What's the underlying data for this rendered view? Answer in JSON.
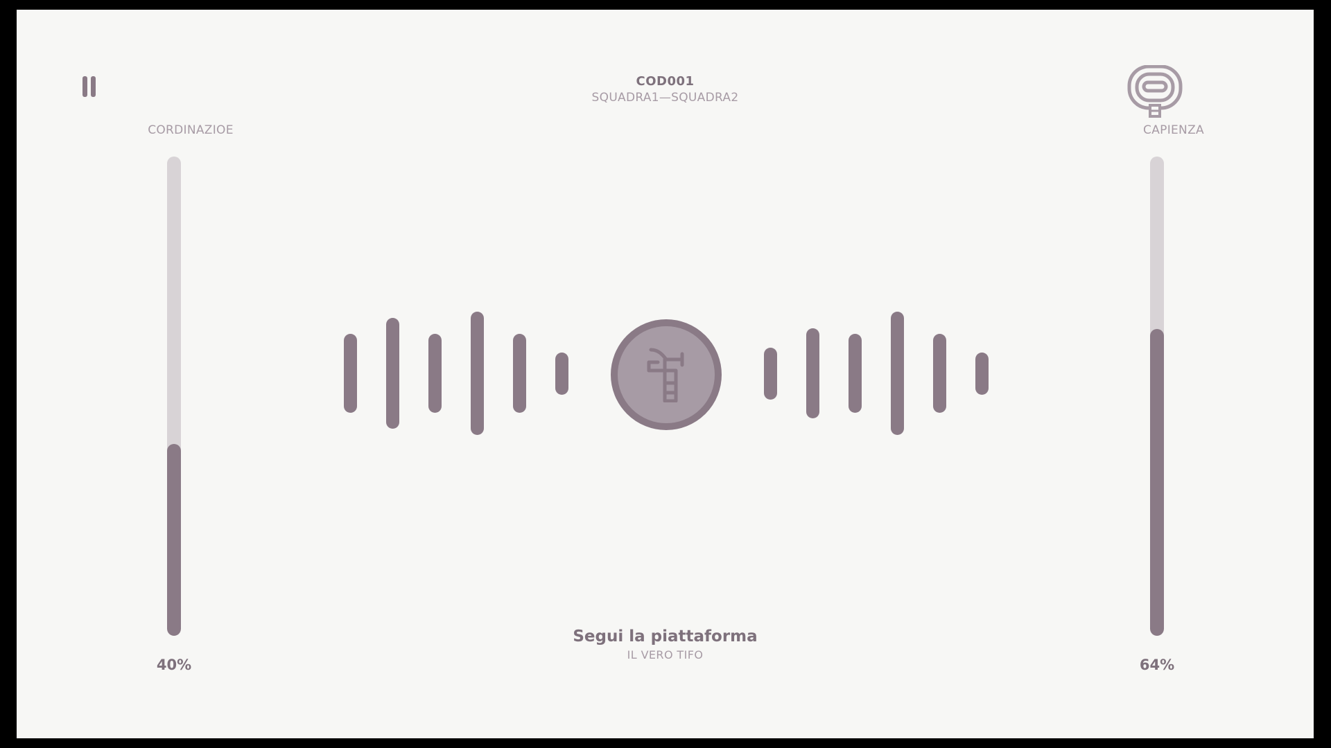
{
  "header": {
    "match_code": "COD001",
    "teams": "SQUADRA1—SQUADRA2"
  },
  "controls": {
    "pause_icon": "pause-icon"
  },
  "left_meter": {
    "label": "CORDINAZIOE",
    "value_text": "40%",
    "level_percent": 40
  },
  "right_meter": {
    "label": "CAPIENZA",
    "value_text": "64%",
    "level_percent": 64,
    "icon": "stadium-logo-icon"
  },
  "center": {
    "icon": "robot-arm-icon"
  },
  "footer": {
    "title": "Segui la piattaforma",
    "subtitle": "IL VERO TIFO"
  },
  "wave": {
    "left_levels": [
      0.64,
      0.9,
      0.64,
      1.0,
      0.64,
      0.34
    ],
    "right_levels": [
      0.42,
      0.73,
      0.64,
      1.0,
      0.64,
      0.34
    ]
  },
  "colors": {
    "accent": "#8A7A86",
    "track": "#D8D3D6",
    "muted_text": "#A79BA5",
    "background": "#F7F7F5"
  }
}
